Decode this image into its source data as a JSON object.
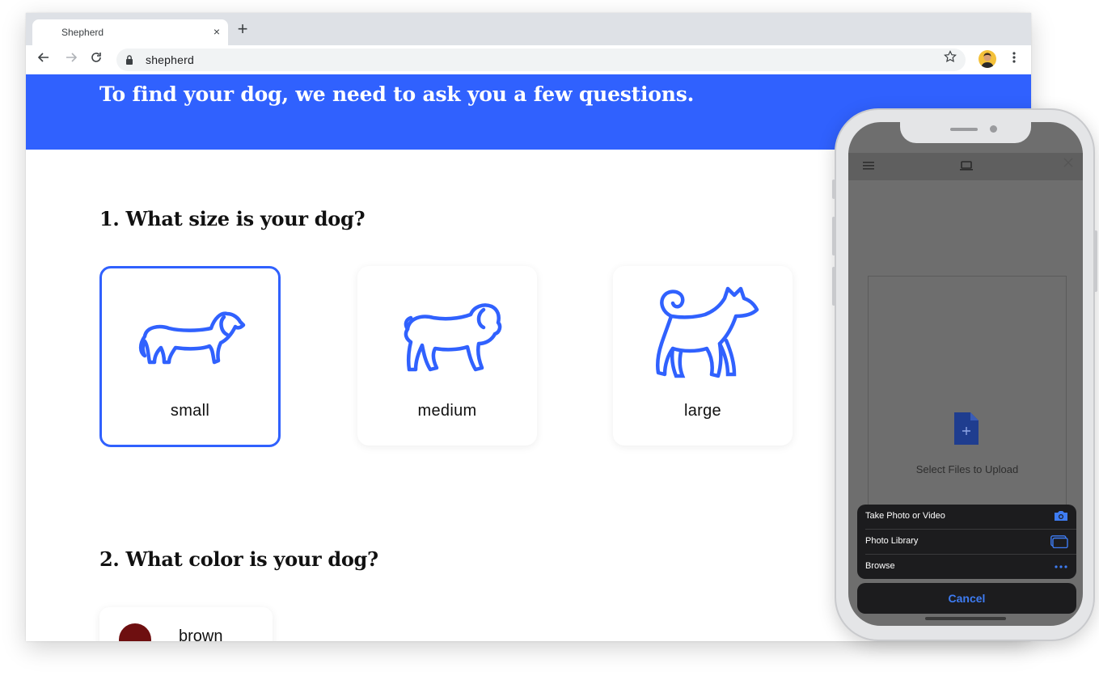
{
  "browser": {
    "tab_title": "Shepherd",
    "tab_close": "×",
    "new_tab": "+",
    "url": "shepherd",
    "icons": [
      "back-arrow-icon",
      "forward-arrow-icon",
      "reload-icon",
      "lock-icon",
      "star-icon",
      "avatar",
      "more-vert-icon"
    ]
  },
  "page": {
    "hero_title": "To find your dog, we need to ask you a few questions.",
    "accent_color": "#3061fe",
    "q1": {
      "title": "1. What size is your dog?",
      "options": [
        {
          "label": "small",
          "selected": true
        },
        {
          "label": "medium",
          "selected": false
        },
        {
          "label": "large",
          "selected": false
        }
      ]
    },
    "q2": {
      "title": "2. What color is your dog?",
      "options": [
        {
          "label": "brown",
          "color": "#6e0f10"
        }
      ]
    }
  },
  "phone": {
    "upload_text": "Select Files to Upload",
    "sheet": {
      "items": [
        {
          "label": "Take Photo or Video",
          "icon": "camera-icon"
        },
        {
          "label": "Photo Library",
          "icon": "photo-library-icon"
        },
        {
          "label": "Browse",
          "icon": "more-horiz-icon"
        }
      ],
      "cancel": "Cancel"
    }
  }
}
